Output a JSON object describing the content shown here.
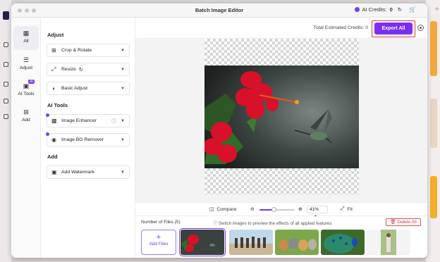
{
  "window": {
    "title": "Batch Image Editor"
  },
  "header": {
    "ai_credits_label": "AI Credits:",
    "ai_credits_value": "0"
  },
  "toolrail": {
    "items": [
      {
        "label": "All",
        "icon": "grid-icon"
      },
      {
        "label": "Adjust",
        "icon": "sliders-icon"
      },
      {
        "label": "AI Tools",
        "icon": "ai-icon",
        "badge": "AI"
      },
      {
        "label": "Add",
        "icon": "add-box-icon"
      }
    ]
  },
  "panel": {
    "adjust_title": "Adjust",
    "ai_title": "AI Tools",
    "add_title": "Add",
    "rows": {
      "crop": "Crop & Rotate",
      "resize": "Resize",
      "basic": "Basic Adjust",
      "enhancer": "Image Enhancer",
      "bg_remover": "Image BG Remover",
      "watermark": "Add Watermark"
    }
  },
  "topbar": {
    "estimated_label": "Total Estimated Credits: 0",
    "export_label": "Export All"
  },
  "zoombar": {
    "compare_label": "Compare",
    "zoom_value": "41%",
    "zoom_level": 0.41,
    "fit_label": "Fit"
  },
  "files": {
    "count_label": "Number of Files (5)",
    "hint": "Switch images to preview the effects of all applied features",
    "delete_label": "Delete All",
    "add_label": "Add Files"
  },
  "colors": {
    "accent": "#7a2ff0",
    "danger": "#e53935"
  }
}
